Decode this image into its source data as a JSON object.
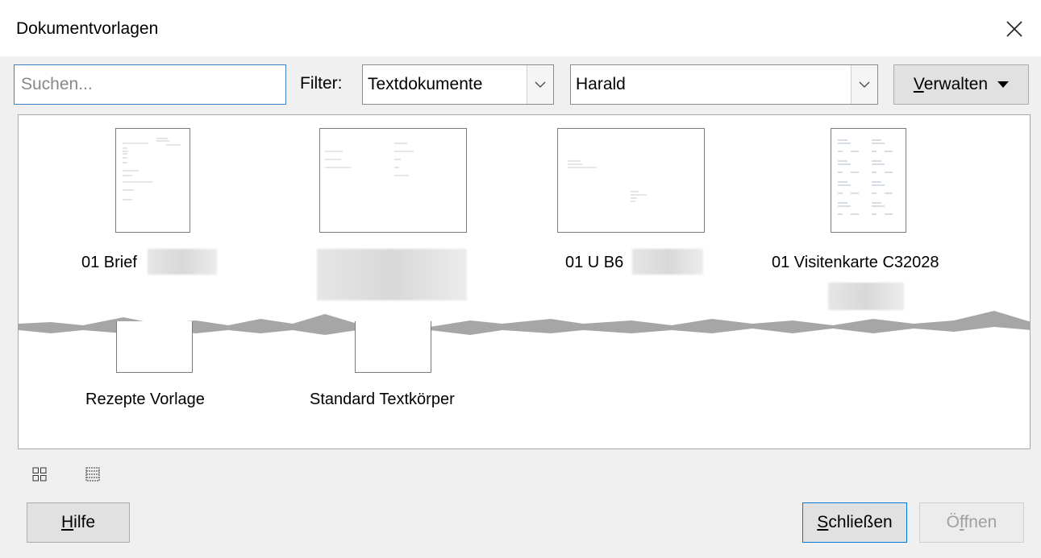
{
  "dialog": {
    "title": "Dokumentvorlagen",
    "close_icon": "close-icon"
  },
  "toolbar": {
    "search_placeholder": "Suchen...",
    "search_value": "",
    "filter_label": "Filter:",
    "filter_value": "Textdokumente",
    "category_value": "Harald",
    "manage_label_mnemonic": "V",
    "manage_label_rest": "erwalten"
  },
  "templates": [
    {
      "label": "01 Brief",
      "thumbnail": "portrait-letter"
    },
    {
      "label": "",
      "thumbnail": "landscape-business-card"
    },
    {
      "label": "01 U B6",
      "thumbnail": "landscape-envelope"
    },
    {
      "label": "01 Visitenkarte C32028",
      "thumbnail": "portrait-card-sheet"
    },
    {
      "label": "Rezepte Vorlage",
      "thumbnail": "blank"
    },
    {
      "label": "Standard Textkörper",
      "thumbnail": "blank"
    }
  ],
  "view": {
    "thumbnail_view_icon": "grid-view-icon",
    "list_view_icon": "list-view-icon"
  },
  "buttons": {
    "help_mnemonic": "H",
    "help_rest": "ilfe",
    "close_mnemonic": "S",
    "close_rest": "chließen",
    "open_pre": "Ö",
    "open_mnemonic": "f",
    "open_rest": "fnen"
  }
}
